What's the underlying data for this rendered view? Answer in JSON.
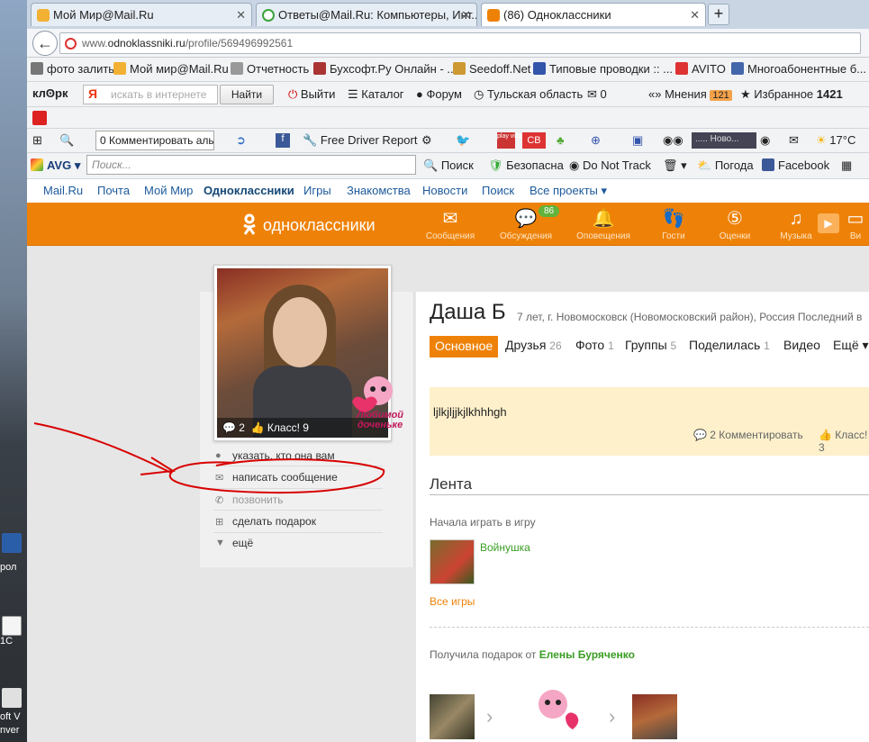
{
  "desktop": {
    "labels": [
      "рол",
      "1С",
      "oft V",
      "nver"
    ]
  },
  "tabs": [
    {
      "label": "Мой Мир@Mail.Ru"
    },
    {
      "label": "Ответы@Mail.Ru: Компьютеры, Инт..."
    },
    {
      "label": "(86) Одноклассники"
    }
  ],
  "address": {
    "prefix": "www.",
    "domain": "odnoklassniki.ru",
    "path": "/profile/569496992561"
  },
  "bookmarks": [
    "фото залить",
    "Мой мир@Mail.Ru",
    "Отчетность",
    "Бухсофт.Ру Онлайн - ...",
    "Seedoff.Net",
    "Типовые проводки :: ...",
    "AVITO",
    "Многоабонентные б..."
  ],
  "yandex_bar": {
    "logo": "клʘрк",
    "search_placeholder": "искать в интернете",
    "search_button": "Найти",
    "items": [
      "Выйти",
      "Каталог",
      "Форум",
      "Тульская область",
      "0",
      "Мнения",
      "Избранное"
    ],
    "mnenia_count": "121",
    "favorites_count": "1421"
  },
  "toolbar3": {
    "comment_select": "0 Комментировать аль",
    "driver": "Free Driver Report",
    "weather_combo": "..... Ново...",
    "temp": "17°C",
    "play_label": "play vida",
    "cb_label": "CB"
  },
  "avg_bar": {
    "logo": "AVG",
    "search_placeholder": "Поиск...",
    "search_btn": "Поиск",
    "safe": "Безопасна",
    "dnt": "Do Not Track",
    "weather": "Погода",
    "facebook": "Facebook"
  },
  "mailnav": [
    "Mail.Ru",
    "Почта",
    "Мой Мир",
    "Одноклассники",
    "Игры",
    "Знакомства",
    "Новости",
    "Поиск",
    "Все проекты"
  ],
  "ok_header": {
    "logo": "одноклассники",
    "badge": "86",
    "nav": [
      "Сообщения",
      "Обсуждения",
      "Оповещения",
      "Гости",
      "Оценки",
      "Музыка",
      "Ви"
    ]
  },
  "profile": {
    "name": "Даша Б",
    "meta": "7 лет, г. Новомосковск (Новомосковский район), Россия  Последний в",
    "photo_comments": "2",
    "photo_class": "Класс! 9",
    "sticker_text": "Любимой доченьке",
    "actions": [
      "указать, кто она вам",
      "написать сообщение",
      "позвонить",
      "сделать подарок",
      "ещё"
    ],
    "tabs": [
      {
        "label": "Основное",
        "count": ""
      },
      {
        "label": "Друзья",
        "count": "26"
      },
      {
        "label": "Фото",
        "count": "1"
      },
      {
        "label": "Группы",
        "count": "5"
      },
      {
        "label": "Поделилась",
        "count": "1"
      },
      {
        "label": "Видео",
        "count": ""
      },
      {
        "label": "Ещё ▾",
        "count": ""
      }
    ],
    "status_text": "ljlkjljjkjlkhhhgh",
    "status_comments": "2 Комментировать",
    "status_class": "Класс! 3"
  },
  "feed": {
    "header": "Лента",
    "game_intro": "Начала играть в игру",
    "game_name": "Войнушка",
    "all_games": "Все игры",
    "gift_prefix": "Получила подарок от",
    "gift_from": "Елены Буряченко"
  },
  "colors": {
    "ok_orange": "#ee8208",
    "green": "#3a9d24",
    "link_blue": "#1d5a9c",
    "annotation_red": "#d80000"
  }
}
